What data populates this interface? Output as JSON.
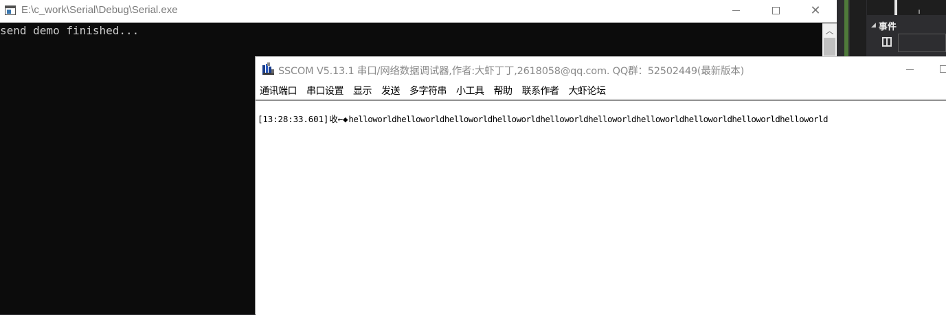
{
  "console": {
    "title": "E:\\c_work\\Serial\\Debug\\Serial.exe",
    "output_lines": [
      "send demo finished..."
    ],
    "icons": {
      "app": "console-icon",
      "minimize": "minimize-icon",
      "maximize": "maximize-icon",
      "close": "close-icon"
    }
  },
  "sscom": {
    "title": "SSCOM V5.13.1 串口/网络数据调试器,作者:大虾丁丁,2618058@qq.com. QQ群：52502449(最新版本)",
    "menu": [
      {
        "label": "通讯端口"
      },
      {
        "label": "串口设置"
      },
      {
        "label": "显示"
      },
      {
        "label": "发送"
      },
      {
        "label": "多字符串"
      },
      {
        "label": "小工具"
      },
      {
        "label": "帮助"
      },
      {
        "label": "联系作者"
      },
      {
        "label": "大虾论坛"
      }
    ],
    "receive": {
      "timestamp": "[13:28:33.601]",
      "direction": "收←◆",
      "payload": "helloworldhelloworldhelloworldhelloworldhelloworldhelloworldhelloworldhelloworldhelloworldhelloworld"
    }
  },
  "ide": {
    "section_title": "事件",
    "icons": {
      "collapse": "collapse-triangle-icon",
      "grid": "grid-view-icon"
    }
  },
  "colors": {
    "console_bg": "#0c0c0c",
    "console_text": "#cccccc",
    "ide_bg": "#2d2d30",
    "ide_accent_green": "#4f7a3a"
  }
}
